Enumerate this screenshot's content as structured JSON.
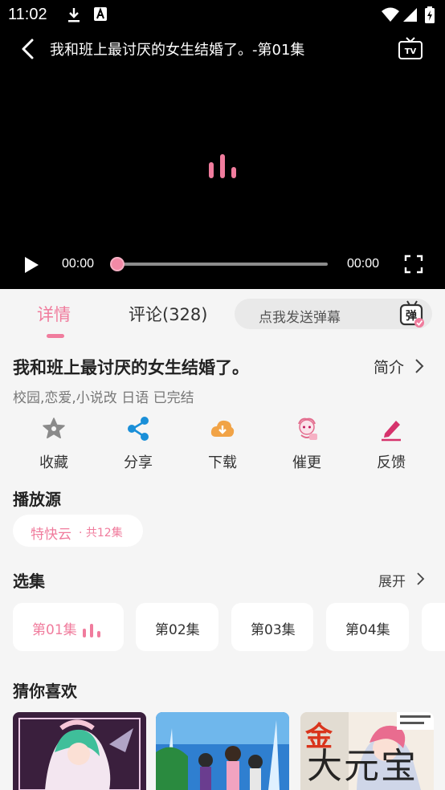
{
  "status_bar": {
    "time": "11:02"
  },
  "player": {
    "title": "我和班上最讨厌的女生结婚了。-第01集",
    "current_time": "00:00",
    "total_time": "00:00",
    "progress": 0
  },
  "tabs": {
    "detail": "详情",
    "comments": "评论(328)",
    "danmaku_placeholder": "点我发送弹幕",
    "danmaku_icon_text": "弹"
  },
  "info": {
    "title": "我和班上最讨厌的女生结婚了。",
    "intro_link": "简介",
    "tags": "校园,恋爱,小说改 日语 已完结"
  },
  "actions": [
    {
      "label": "收藏",
      "icon": "star-icon"
    },
    {
      "label": "分享",
      "icon": "share-icon"
    },
    {
      "label": "下载",
      "icon": "download-cloud-icon"
    },
    {
      "label": "催更",
      "icon": "urge-update-icon"
    },
    {
      "label": "反馈",
      "icon": "edit-pencil-icon"
    }
  ],
  "source": {
    "heading": "播放源",
    "name": "特快云",
    "count": "· 共12集"
  },
  "episodes": {
    "heading": "选集",
    "expand": "展开",
    "items": [
      "第01集",
      "第02集",
      "第03集",
      "第04集"
    ],
    "active_index": 0
  },
  "recommend": {
    "heading": "猜你喜欢"
  },
  "watermark": "大元宝",
  "colors": {
    "accent": "#f07c9d",
    "share_blue": "#1a8fd8",
    "download_orange": "#f1a346",
    "feedback_magenta": "#d6336c",
    "star_gray": "#8a8a8a"
  }
}
